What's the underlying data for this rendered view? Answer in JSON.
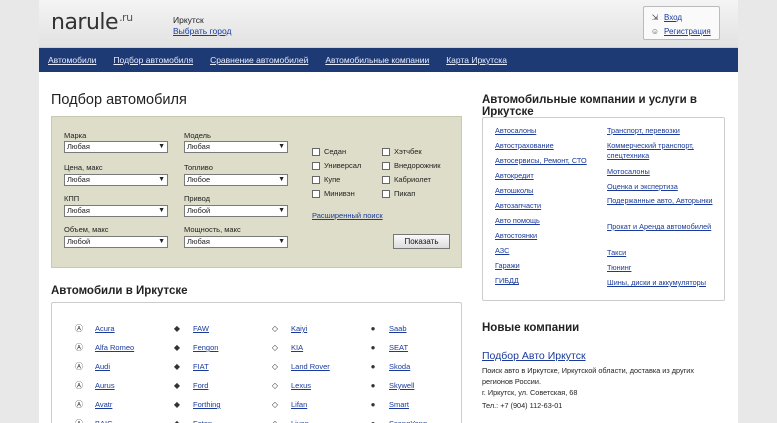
{
  "header": {
    "logo": "narule",
    "logo_tld": ".ru",
    "city": "Иркутск",
    "choose_city": "Выбрать город",
    "login": "Вход",
    "register": "Регистрация"
  },
  "nav": [
    "Автомобили",
    "Подбор автомобиля",
    "Сравнение автомобилей",
    "Автомобильные компании",
    "Карта Иркутска"
  ],
  "filter": {
    "title": "Подбор автомобиля",
    "fields": [
      {
        "label": "Марка",
        "value": "Любая"
      },
      {
        "label": "Модель",
        "value": "Любая"
      },
      {
        "label": "Цена, макс",
        "value": "Любая"
      },
      {
        "label": "Топливо",
        "value": "Любое"
      },
      {
        "label": "КПП",
        "value": "Любая"
      },
      {
        "label": "Привод",
        "value": "Любой"
      },
      {
        "label": "Объем, макс",
        "value": "Любой"
      },
      {
        "label": "Мощность, макс",
        "value": "Любая"
      }
    ],
    "body_types": [
      "Седан",
      "Хэтчбек",
      "Универсал",
      "Внедорожник",
      "Купе",
      "Кабриолет",
      "Минивэн",
      "Пикап"
    ],
    "advanced": "Расширенный поиск",
    "show": "Показать"
  },
  "brands_title": "Автомобили в Иркутске",
  "brands": [
    [
      "Acura",
      "FAW",
      "Kaiyi",
      "Saab"
    ],
    [
      "Alfa Romeo",
      "Fengon",
      "KIA",
      "SEAT"
    ],
    [
      "Audi",
      "FIAT",
      "Land Rover",
      "Skoda"
    ],
    [
      "Aurus",
      "Ford",
      "Lexus",
      "Skywell"
    ],
    [
      "Avatr",
      "Forthing",
      "Lifan",
      "Smart"
    ],
    [
      "BAIC",
      "Foton",
      "Livan",
      "SsangYong"
    ]
  ],
  "brand_icons": [
    [
      "acura-icon",
      "faw-icon",
      "kaiyi-icon",
      "saab-icon"
    ],
    [
      "alfa-romeo-icon",
      "fengon-icon",
      "kia-icon",
      "seat-icon"
    ],
    [
      "audi-icon",
      "fiat-icon",
      "land-rover-icon",
      "skoda-icon"
    ],
    [
      "aurus-icon",
      "ford-icon",
      "lexus-icon",
      "skywell-icon"
    ],
    [
      "avatr-icon",
      "forthing-icon",
      "lifan-icon",
      "smart-icon"
    ],
    [
      "baic-icon",
      "foton-icon",
      "livan-icon",
      "ssangyong-icon"
    ]
  ],
  "companies_title": "Автомобильные компании и услуги в Иркутске",
  "companies": {
    "left": [
      "Автосалоны",
      "Автострахование",
      "Автосервисы, Ремонт, СТО",
      "Автокредит",
      "Автошколы",
      "Автозапчасти",
      "Авто помощь",
      "Автостоянки",
      "АЗС",
      "Гаражи",
      "ГИБДД"
    ],
    "right": [
      "Транспорт, перевозки",
      "Коммерческий транспорт, спецтехника",
      "Мотосалоны",
      "Оценка и экспертиза",
      "Подержанные авто, Авторынки",
      "Прокат и Аренда автомобилей",
      "Такси",
      "Тюнинг",
      "Шины, диски и аккумуляторы"
    ]
  },
  "new_companies": {
    "title": "Новые компании",
    "name": "Подбор Авто Иркутск",
    "description": "Поиск авто в Иркутске, Иркутской области, доставка из других регионов России.",
    "address": "г. Иркутск, ул. Советская, 68",
    "phone": "Тел.: +7 (904) 112-63-01"
  }
}
